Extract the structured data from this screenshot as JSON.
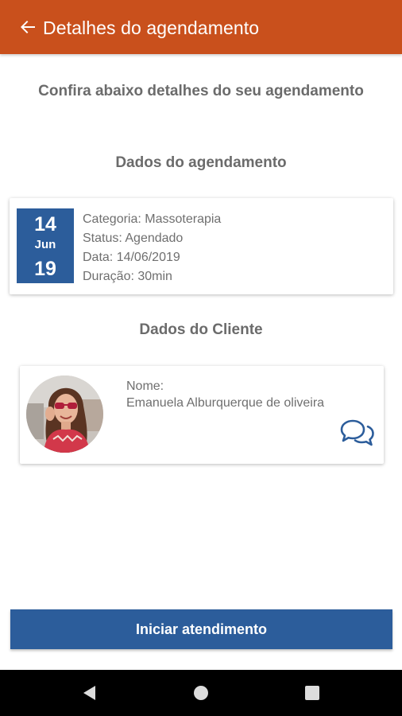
{
  "header": {
    "title": "Detalhes do agendamento",
    "back_icon": "arrow-left-icon",
    "background": "#c9501c"
  },
  "subtitle": "Confira abaixo detalhes do seu agendamento",
  "appointment_section": {
    "title": "Dados do agendamento",
    "date": {
      "day": "14",
      "month": "Jun",
      "year": "19"
    },
    "category": "Categoria: Massoterapia",
    "status": "Status: Agendado",
    "date_text": "Data: 14/06/2019",
    "duration": "Duração: 30min"
  },
  "client_section": {
    "title": "Dados do Cliente",
    "name_label": "Nome:",
    "name": "Emanuela Alburquerque de oliveira",
    "chat_icon": "chat-bubbles-icon"
  },
  "action_button": {
    "label": "Iniciar atendimento",
    "background": "#2c5d9b"
  },
  "system_nav": {
    "back_icon": "nav-back-icon",
    "home_icon": "nav-home-icon",
    "recents_icon": "nav-recents-icon"
  },
  "colors": {
    "primary": "#2c5d9b",
    "accent": "#c9501c",
    "text": "#6f6f6f"
  }
}
